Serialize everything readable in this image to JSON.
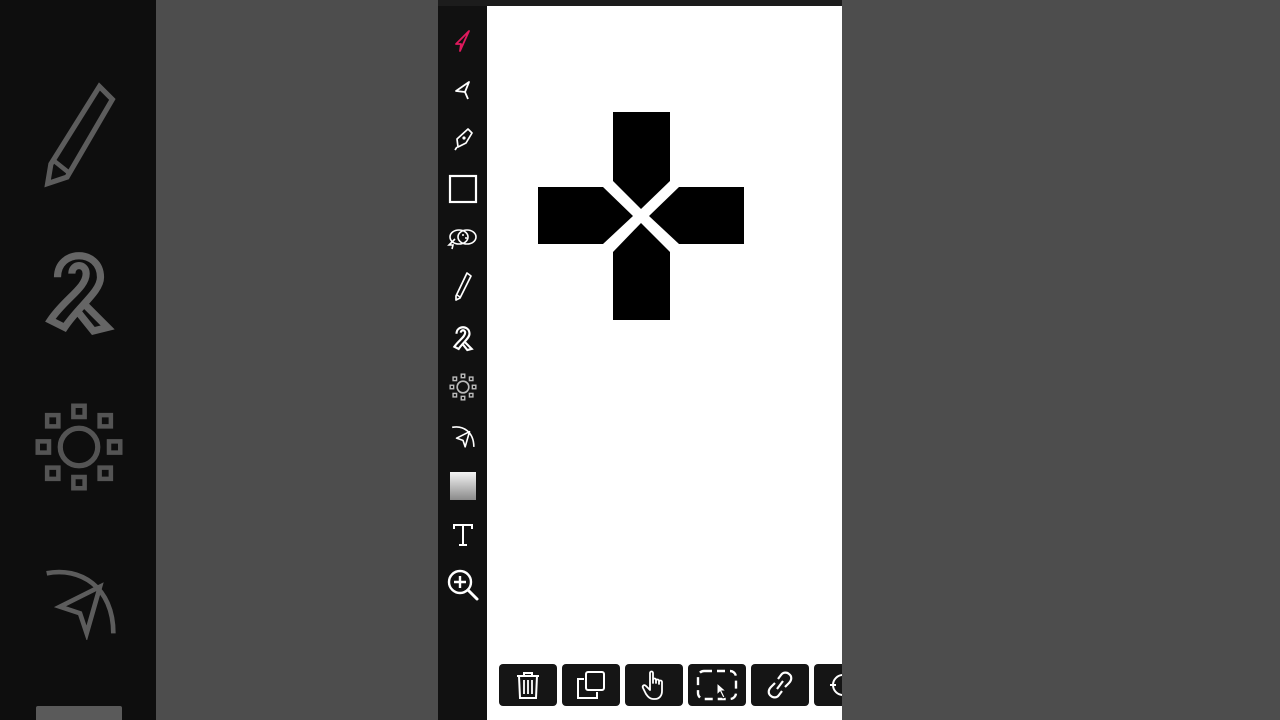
{
  "colors": {
    "side_background": "#4d4d4d",
    "toolbar_background": "#111111",
    "canvas_background": "#ffffff",
    "active_tool": "#e0195d",
    "icon": "#ffffff",
    "shape_fill": "#000000"
  },
  "toolbar": {
    "active_tool": "selection-tool",
    "tools": [
      "selection-arrow-icon",
      "direct-select-icon",
      "pen-nib-icon",
      "rectangle-icon",
      "shape-builder-icon",
      "pencil-icon",
      "ribbon-brush-icon",
      "pattern-icon",
      "bend-tool-icon",
      "gradient-icon",
      "text-icon",
      "zoom-icon"
    ]
  },
  "canvas": {
    "objects": [
      "plus-cross-shape"
    ]
  },
  "action_bar": {
    "buttons": [
      "trash-icon",
      "duplicate-icon",
      "hand-pointer-icon",
      "dashed-select-icon",
      "link-icon",
      "more-icon"
    ]
  }
}
